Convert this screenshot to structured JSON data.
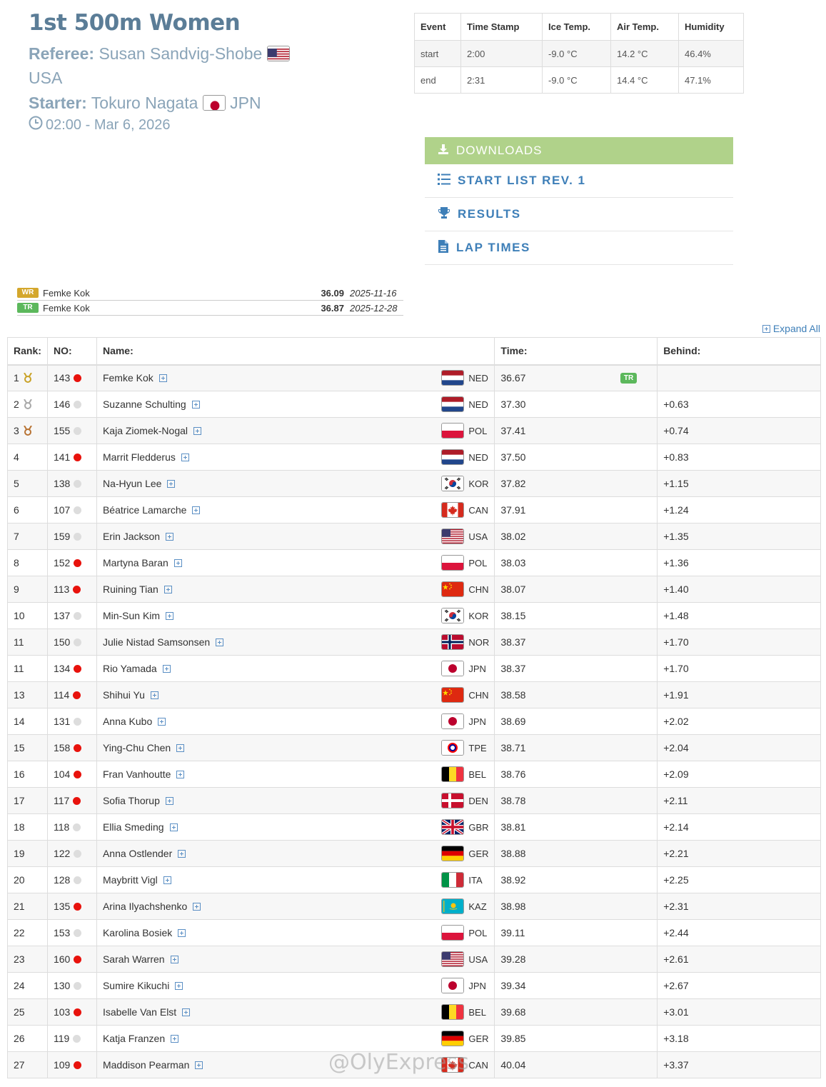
{
  "header": {
    "title": "1st 500m Women",
    "referee_label": "Referee:",
    "referee_name": "Susan Sandvig-Shobe",
    "referee_country": "USA",
    "starter_label": "Starter:",
    "starter_name": "Tokuro Nagata",
    "starter_country": "JPN",
    "datetime": "02:00 - Mar 6, 2026"
  },
  "conditions": {
    "headers": [
      "Event",
      "Time Stamp",
      "Ice Temp.",
      "Air Temp.",
      "Humidity"
    ],
    "rows": [
      [
        "start",
        "2:00",
        "-9.0 °C",
        "14.2 °C",
        "46.4%"
      ],
      [
        "end",
        "2:31",
        "-9.0 °C",
        "14.4 °C",
        "47.1%"
      ]
    ]
  },
  "downloads": {
    "header": "DOWNLOADS",
    "items": [
      "START LIST REV. 1",
      "RESULTS",
      "LAP TIMES"
    ]
  },
  "records": [
    {
      "badge": "WR",
      "color": "#d4a72c",
      "name": "Femke Kok",
      "time": "36.09",
      "date": "2025-11-16"
    },
    {
      "badge": "TR",
      "color": "#5cb85c",
      "name": "Femke Kok",
      "time": "36.87",
      "date": "2025-12-28"
    }
  ],
  "expand_all": "Expand All",
  "table": {
    "headers": [
      "Rank:",
      "NO:",
      "Name:",
      "Time:",
      "Behind:"
    ],
    "rows": [
      {
        "rank": "1",
        "medal": "gold",
        "no": "143",
        "dot": "red",
        "name": "Femke Kok",
        "country": "NED",
        "time": "36.67",
        "badge": "TR",
        "behind": ""
      },
      {
        "rank": "2",
        "medal": "silver",
        "no": "146",
        "dot": "white",
        "name": "Suzanne Schulting",
        "country": "NED",
        "time": "37.30",
        "badge": "",
        "behind": "+0.63"
      },
      {
        "rank": "3",
        "medal": "bronze",
        "no": "155",
        "dot": "white",
        "name": "Kaja Ziomek-Nogal",
        "country": "POL",
        "time": "37.41",
        "badge": "",
        "behind": "+0.74"
      },
      {
        "rank": "4",
        "medal": "",
        "no": "141",
        "dot": "red",
        "name": "Marrit Fledderus",
        "country": "NED",
        "time": "37.50",
        "badge": "",
        "behind": "+0.83"
      },
      {
        "rank": "5",
        "medal": "",
        "no": "138",
        "dot": "white",
        "name": "Na-Hyun Lee",
        "country": "KOR",
        "time": "37.82",
        "badge": "",
        "behind": "+1.15"
      },
      {
        "rank": "6",
        "medal": "",
        "no": "107",
        "dot": "white",
        "name": "Béatrice Lamarche",
        "country": "CAN",
        "time": "37.91",
        "badge": "",
        "behind": "+1.24"
      },
      {
        "rank": "7",
        "medal": "",
        "no": "159",
        "dot": "white",
        "name": "Erin Jackson",
        "country": "USA",
        "time": "38.02",
        "badge": "",
        "behind": "+1.35"
      },
      {
        "rank": "8",
        "medal": "",
        "no": "152",
        "dot": "red",
        "name": "Martyna Baran",
        "country": "POL",
        "time": "38.03",
        "badge": "",
        "behind": "+1.36"
      },
      {
        "rank": "9",
        "medal": "",
        "no": "113",
        "dot": "red",
        "name": "Ruining Tian",
        "country": "CHN",
        "time": "38.07",
        "badge": "",
        "behind": "+1.40"
      },
      {
        "rank": "10",
        "medal": "",
        "no": "137",
        "dot": "white",
        "name": "Min-Sun Kim",
        "country": "KOR",
        "time": "38.15",
        "badge": "",
        "behind": "+1.48"
      },
      {
        "rank": "11",
        "medal": "",
        "no": "150",
        "dot": "white",
        "name": "Julie Nistad Samsonsen",
        "country": "NOR",
        "time": "38.37",
        "badge": "",
        "behind": "+1.70"
      },
      {
        "rank": "11",
        "medal": "",
        "no": "134",
        "dot": "red",
        "name": "Rio Yamada",
        "country": "JPN",
        "time": "38.37",
        "badge": "",
        "behind": "+1.70"
      },
      {
        "rank": "13",
        "medal": "",
        "no": "114",
        "dot": "red",
        "name": "Shihui Yu",
        "country": "CHN",
        "time": "38.58",
        "badge": "",
        "behind": "+1.91"
      },
      {
        "rank": "14",
        "medal": "",
        "no": "131",
        "dot": "white",
        "name": "Anna Kubo",
        "country": "JPN",
        "time": "38.69",
        "badge": "",
        "behind": "+2.02"
      },
      {
        "rank": "15",
        "medal": "",
        "no": "158",
        "dot": "red",
        "name": "Ying-Chu Chen",
        "country": "TPE",
        "time": "38.71",
        "badge": "",
        "behind": "+2.04"
      },
      {
        "rank": "16",
        "medal": "",
        "no": "104",
        "dot": "red",
        "name": "Fran Vanhoutte",
        "country": "BEL",
        "time": "38.76",
        "badge": "",
        "behind": "+2.09"
      },
      {
        "rank": "17",
        "medal": "",
        "no": "117",
        "dot": "red",
        "name": "Sofia Thorup",
        "country": "DEN",
        "time": "38.78",
        "badge": "",
        "behind": "+2.11"
      },
      {
        "rank": "18",
        "medal": "",
        "no": "118",
        "dot": "white",
        "name": "Ellia Smeding",
        "country": "GBR",
        "time": "38.81",
        "badge": "",
        "behind": "+2.14"
      },
      {
        "rank": "19",
        "medal": "",
        "no": "122",
        "dot": "white",
        "name": "Anna Ostlender",
        "country": "GER",
        "time": "38.88",
        "badge": "",
        "behind": "+2.21"
      },
      {
        "rank": "20",
        "medal": "",
        "no": "128",
        "dot": "white",
        "name": "Maybritt Vigl",
        "country": "ITA",
        "time": "38.92",
        "badge": "",
        "behind": "+2.25"
      },
      {
        "rank": "21",
        "medal": "",
        "no": "135",
        "dot": "red",
        "name": "Arina Ilyachshenko",
        "country": "KAZ",
        "time": "38.98",
        "badge": "",
        "behind": "+2.31"
      },
      {
        "rank": "22",
        "medal": "",
        "no": "153",
        "dot": "white",
        "name": "Karolina Bosiek",
        "country": "POL",
        "time": "39.11",
        "badge": "",
        "behind": "+2.44"
      },
      {
        "rank": "23",
        "medal": "",
        "no": "160",
        "dot": "red",
        "name": "Sarah Warren",
        "country": "USA",
        "time": "39.28",
        "badge": "",
        "behind": "+2.61"
      },
      {
        "rank": "24",
        "medal": "",
        "no": "130",
        "dot": "white",
        "name": "Sumire Kikuchi",
        "country": "JPN",
        "time": "39.34",
        "badge": "",
        "behind": "+2.67"
      },
      {
        "rank": "25",
        "medal": "",
        "no": "103",
        "dot": "red",
        "name": "Isabelle Van Elst",
        "country": "BEL",
        "time": "39.68",
        "badge": "",
        "behind": "+3.01"
      },
      {
        "rank": "26",
        "medal": "",
        "no": "119",
        "dot": "white",
        "name": "Katja Franzen",
        "country": "GER",
        "time": "39.85",
        "badge": "",
        "behind": "+3.18"
      },
      {
        "rank": "27",
        "medal": "",
        "no": "109",
        "dot": "red",
        "name": "Maddison Pearman",
        "country": "CAN",
        "time": "40.04",
        "badge": "",
        "behind": "+3.37"
      }
    ]
  },
  "watermark": "@OlyExpress",
  "colors": {
    "accent": "#3e7fb8",
    "title": "#5b7d97",
    "downloads_bg": "#b0d28a",
    "red_dot": "#e8120c",
    "white_dot": "#dddddd"
  }
}
